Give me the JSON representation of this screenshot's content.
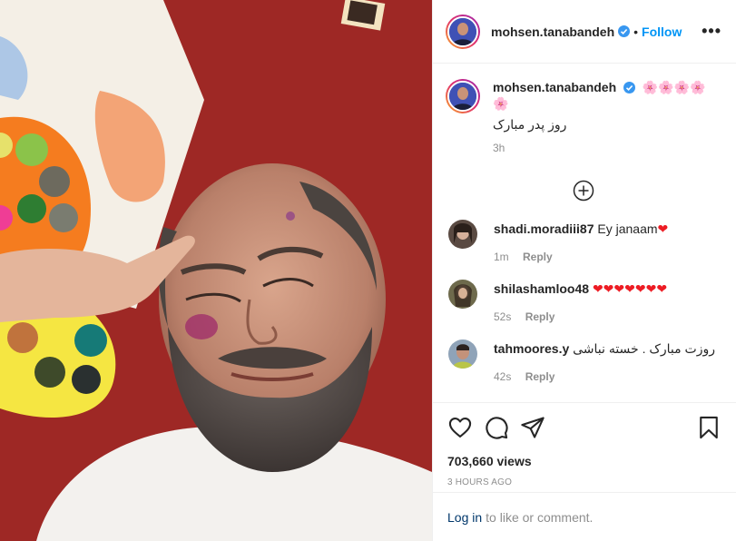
{
  "post": {
    "username": "mohsen.tanabandeh",
    "follow_label": "Follow",
    "dot": "•",
    "more_label": "•••",
    "caption_flowers": "🌸🌸🌸🌸",
    "caption_flowers2": "🌸",
    "caption_text": "روز پدر مبارک",
    "caption_time": "3h"
  },
  "comments": [
    {
      "user": "shadi.moradiii87",
      "text": "Ey janaam",
      "hearts": "❤",
      "time": "1m",
      "reply": "Reply"
    },
    {
      "user": "shilashamloo48",
      "text": "",
      "hearts": "❤❤❤❤❤❤❤",
      "time": "52s",
      "reply": "Reply"
    },
    {
      "user": "tahmoores.y",
      "text": "روزت مبارک . خسته نباشی",
      "hearts": "",
      "time": "42s",
      "reply": "Reply"
    }
  ],
  "stats": {
    "views": "703,660 views",
    "posted_ago": "3 HOURS AGO"
  },
  "login": {
    "link": "Log in",
    "text": "to like or comment."
  },
  "colors": {
    "accent": "#0095f6",
    "heart": "#ed1c24",
    "rug": "#9e2a25"
  }
}
